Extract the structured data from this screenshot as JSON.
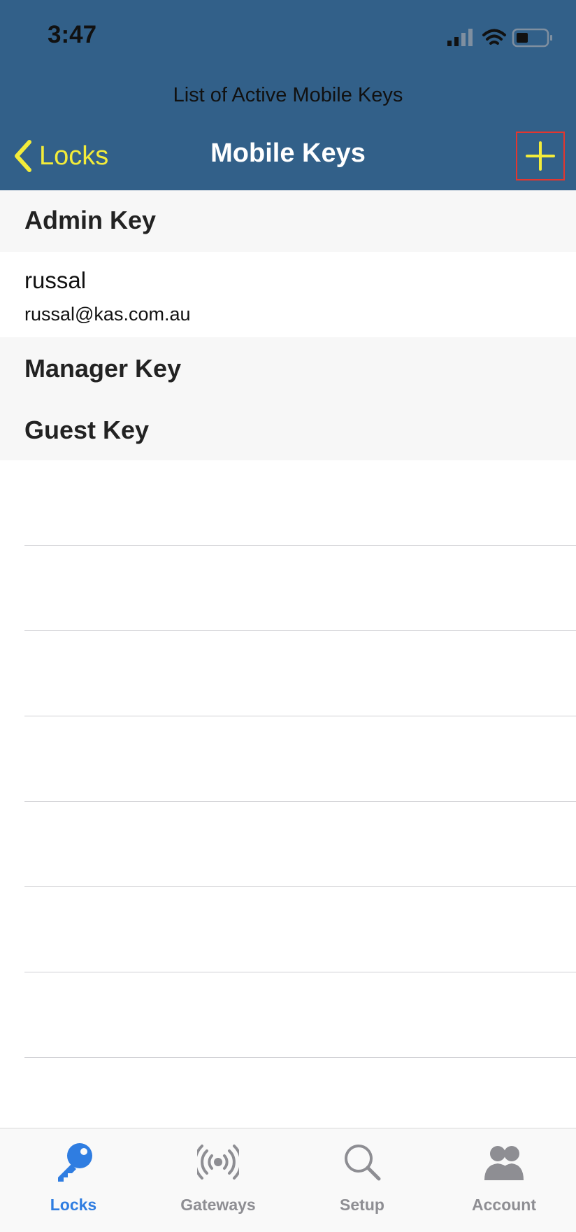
{
  "status_bar": {
    "time": "3:47"
  },
  "header": {
    "subtitle": "List of Active Mobile Keys",
    "back_label": "Locks",
    "title": "Mobile Keys"
  },
  "colors": {
    "nav_bg": "#326089",
    "accent_yellow": "#f3ec3a",
    "tab_active": "#2f7de1",
    "tab_inactive": "#8e8e93",
    "highlight_border": "#e3362f"
  },
  "sections": [
    {
      "title": "Admin Key",
      "items": [
        {
          "name": "russal",
          "email": "russal@kas.com.au"
        }
      ]
    },
    {
      "title": "Manager Key",
      "items": []
    },
    {
      "title": "Guest Key",
      "items": []
    }
  ],
  "tabs": [
    {
      "label": "Locks",
      "icon": "key-icon",
      "active": true
    },
    {
      "label": "Gateways",
      "icon": "broadcast-icon",
      "active": false
    },
    {
      "label": "Setup",
      "icon": "search-icon",
      "active": false
    },
    {
      "label": "Account",
      "icon": "users-icon",
      "active": false
    }
  ]
}
